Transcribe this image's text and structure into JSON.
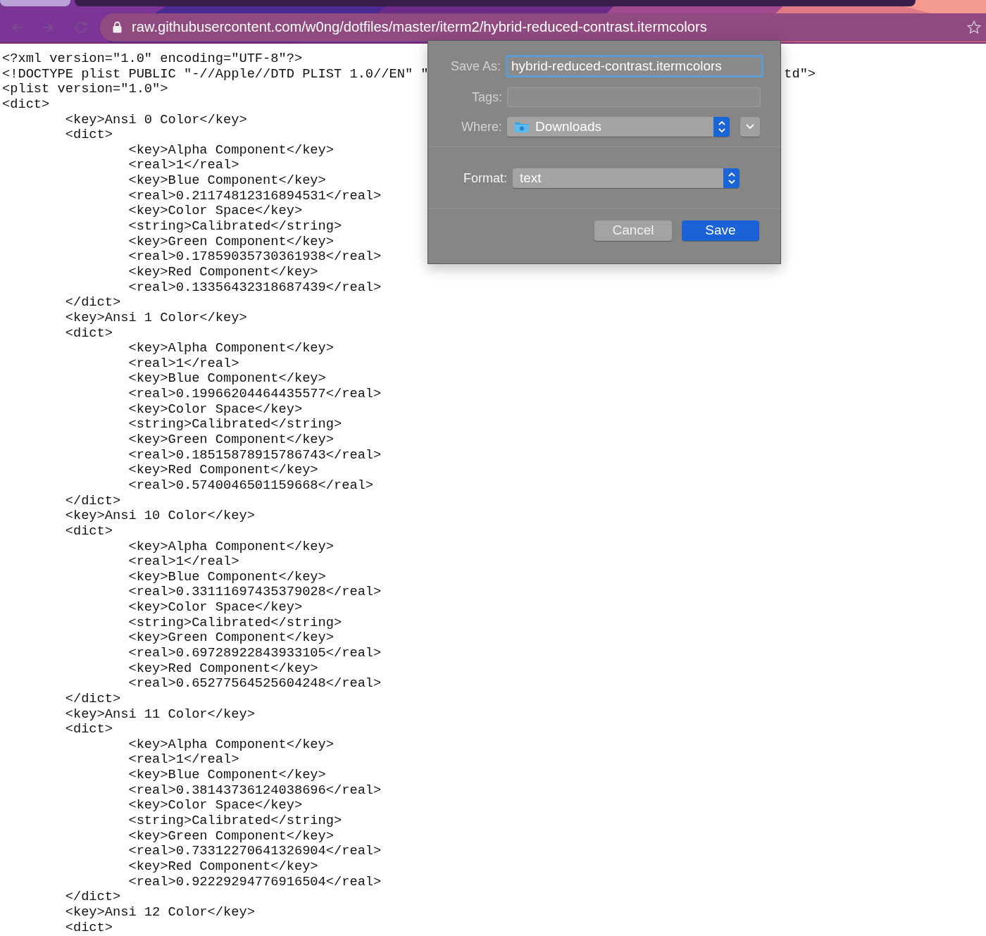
{
  "browser": {
    "nav_buttons": [
      {
        "kind": "back",
        "disabled": true
      },
      {
        "kind": "forward",
        "disabled": true
      },
      {
        "kind": "reload",
        "disabled": true
      }
    ],
    "url": "raw.githubusercontent.com/w0ng/dotfiles/master/iterm2/hybrid-reduced-contrast.itermcolors"
  },
  "document": {
    "lines": [
      {
        "text": "<?xml version=\"1.0\" encoding=\"UTF-8\"?>"
      },
      {
        "text": "<!DOCTYPE plist PUBLIC \"-//Apple//DTD PLIST 1.0//EN\" \"",
        "tail": "td\">"
      },
      {
        "text": "<plist version=\"1.0\">"
      },
      {
        "text": "<dict>"
      },
      {
        "text": "\t<key>Ansi 0 Color</key>"
      },
      {
        "text": "\t<dict>"
      },
      {
        "text": "\t\t<key>Alpha Component</key>"
      },
      {
        "text": "\t\t<real>1</real>"
      },
      {
        "text": "\t\t<key>Blue Component</key>"
      },
      {
        "text": "\t\t<real>0.21174812316894531</real>"
      },
      {
        "text": "\t\t<key>Color Space</key>"
      },
      {
        "text": "\t\t<string>Calibrated</string>"
      },
      {
        "text": "\t\t<key>Green Component</key>"
      },
      {
        "text": "\t\t<real>0.17859035730361938</real>"
      },
      {
        "text": "\t\t<key>Red Component</key>"
      },
      {
        "text": "\t\t<real>0.13356432318687439</real>"
      },
      {
        "text": "\t</dict>"
      },
      {
        "text": "\t<key>Ansi 1 Color</key>"
      },
      {
        "text": "\t<dict>"
      },
      {
        "text": "\t\t<key>Alpha Component</key>"
      },
      {
        "text": "\t\t<real>1</real>"
      },
      {
        "text": "\t\t<key>Blue Component</key>"
      },
      {
        "text": "\t\t<real>0.19966204464435577</real>"
      },
      {
        "text": "\t\t<key>Color Space</key>"
      },
      {
        "text": "\t\t<string>Calibrated</string>"
      },
      {
        "text": "\t\t<key>Green Component</key>"
      },
      {
        "text": "\t\t<real>0.18515878915786743</real>"
      },
      {
        "text": "\t\t<key>Red Component</key>"
      },
      {
        "text": "\t\t<real>0.5740046501159668</real>"
      },
      {
        "text": "\t</dict>"
      },
      {
        "text": "\t<key>Ansi 10 Color</key>"
      },
      {
        "text": "\t<dict>"
      },
      {
        "text": "\t\t<key>Alpha Component</key>"
      },
      {
        "text": "\t\t<real>1</real>"
      },
      {
        "text": "\t\t<key>Blue Component</key>"
      },
      {
        "text": "\t\t<real>0.33111697435379028</real>"
      },
      {
        "text": "\t\t<key>Color Space</key>"
      },
      {
        "text": "\t\t<string>Calibrated</string>"
      },
      {
        "text": "\t\t<key>Green Component</key>"
      },
      {
        "text": "\t\t<real>0.69728922843933105</real>"
      },
      {
        "text": "\t\t<key>Red Component</key>"
      },
      {
        "text": "\t\t<real>0.65277564525604248</real>"
      },
      {
        "text": "\t</dict>"
      },
      {
        "text": "\t<key>Ansi 11 Color</key>"
      },
      {
        "text": "\t<dict>"
      },
      {
        "text": "\t\t<key>Alpha Component</key>"
      },
      {
        "text": "\t\t<real>1</real>"
      },
      {
        "text": "\t\t<key>Blue Component</key>"
      },
      {
        "text": "\t\t<real>0.38143736124038696</real>"
      },
      {
        "text": "\t\t<key>Color Space</key>"
      },
      {
        "text": "\t\t<string>Calibrated</string>"
      },
      {
        "text": "\t\t<key>Green Component</key>"
      },
      {
        "text": "\t\t<real>0.73312270641326904</real>"
      },
      {
        "text": "\t\t<key>Red Component</key>"
      },
      {
        "text": "\t\t<real>0.92229294776916504</real>"
      },
      {
        "text": "\t</dict>"
      },
      {
        "text": "\t<key>Ansi 12 Color</key>"
      },
      {
        "text": "\t<dict>"
      }
    ]
  },
  "save_dialog": {
    "save_as": {
      "label": "Save As:",
      "value": "hybrid-reduced-contrast.itermcolors",
      "focused": true
    },
    "tags": {
      "label": "Tags:"
    },
    "where": {
      "label": "Where:",
      "value": "Downloads"
    },
    "format": {
      "label": "Format:",
      "value": "text"
    },
    "buttons": [
      {
        "label": "Cancel",
        "default": false
      },
      {
        "label": "Save",
        "default": true
      }
    ]
  }
}
